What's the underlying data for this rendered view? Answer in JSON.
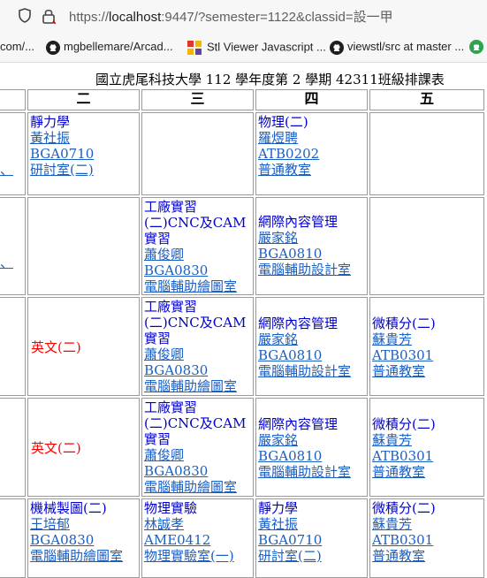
{
  "browser": {
    "url_prefix": "https://",
    "url_host": "localhost",
    "url_rest": ":9447/?semester=1122&classid=設一甲",
    "bookmarks": [
      {
        "label": "com/...",
        "icon": "none"
      },
      {
        "label": "mgbellemare/Arcad...",
        "icon": "github-icon"
      },
      {
        "label": "Stl Viewer Javascript ...",
        "icon": "stl-icon"
      },
      {
        "label": "viewstl/src at master ...",
        "icon": "github-icon"
      }
    ]
  },
  "page": {
    "title": "國立虎尾科技大學 112 學年度第 2 學期 42311班級排課表",
    "days": [
      "二",
      "三",
      "四",
      "五"
    ],
    "left_marks": [
      "、",
      "、"
    ],
    "cells": {
      "r1": {
        "d2": {
          "course": "靜力學",
          "teacher": "黃社振",
          "room": "BGA0710",
          "place": "研討室(二)"
        },
        "d4": {
          "course": "物理(二)",
          "teacher": "羅煜聘",
          "room": "ATB0202",
          "place": "普通教室"
        }
      },
      "r2": {
        "d3": {
          "course": "工廠實習(二)CNC及CAM實習",
          "teacher": "蕭俊卿",
          "room": "BGA0830",
          "place": "電腦輔助繪圖室"
        },
        "d4": {
          "course": "網際內容管理",
          "teacher": "嚴家銘",
          "room": "BGA0810",
          "place": "電腦輔助設計室"
        }
      },
      "r3": {
        "d2": {
          "course": "英文(二)"
        },
        "d3": {
          "course": "工廠實習(二)CNC及CAM實習",
          "teacher": "蕭俊卿",
          "room": "BGA0830",
          "place": "電腦輔助繪圖室"
        },
        "d4": {
          "course": "網際內容管理",
          "teacher": "嚴家銘",
          "room": "BGA0810",
          "place": "電腦輔助設計室"
        },
        "d5": {
          "course": "微積分(二)",
          "teacher": "蘇貴芳",
          "room": "ATB0301",
          "place": "普通教室"
        }
      },
      "r4": {
        "d2": {
          "course": "英文(二)"
        },
        "d3": {
          "course": "工廠實習(二)CNC及CAM實習",
          "teacher": "蕭俊卿",
          "room": "BGA0830",
          "place": "電腦輔助繪圖室"
        },
        "d4": {
          "course": "網際內容管理",
          "teacher": "嚴家銘",
          "room": "BGA0810",
          "place": "電腦輔助設計室"
        },
        "d5": {
          "course": "微積分(二)",
          "teacher": "蘇貴芳",
          "room": "ATB0301",
          "place": "普通教室"
        }
      },
      "r5": {
        "d2": {
          "course": "機械製圖(二)",
          "teacher": "王培郁",
          "room": "BGA0830",
          "place": "電腦輔助繪圖室"
        },
        "d3": {
          "course": "物理實驗",
          "teacher": "林誠孝",
          "room": "AME0412",
          "place": "物理實驗室(一)"
        },
        "d4": {
          "course": "靜力學",
          "teacher": "黃社振",
          "room": "BGA0710",
          "place": "研討室(二)"
        },
        "d5": {
          "course": "微積分(二)",
          "teacher": "蘇貴芳",
          "room": "ATB0301",
          "place": "普通教室"
        }
      }
    },
    "colors": {
      "link": "#1a5fc4",
      "course": "#0000cc",
      "required_english": "#ff0000",
      "border": "#9a9a9a"
    }
  }
}
